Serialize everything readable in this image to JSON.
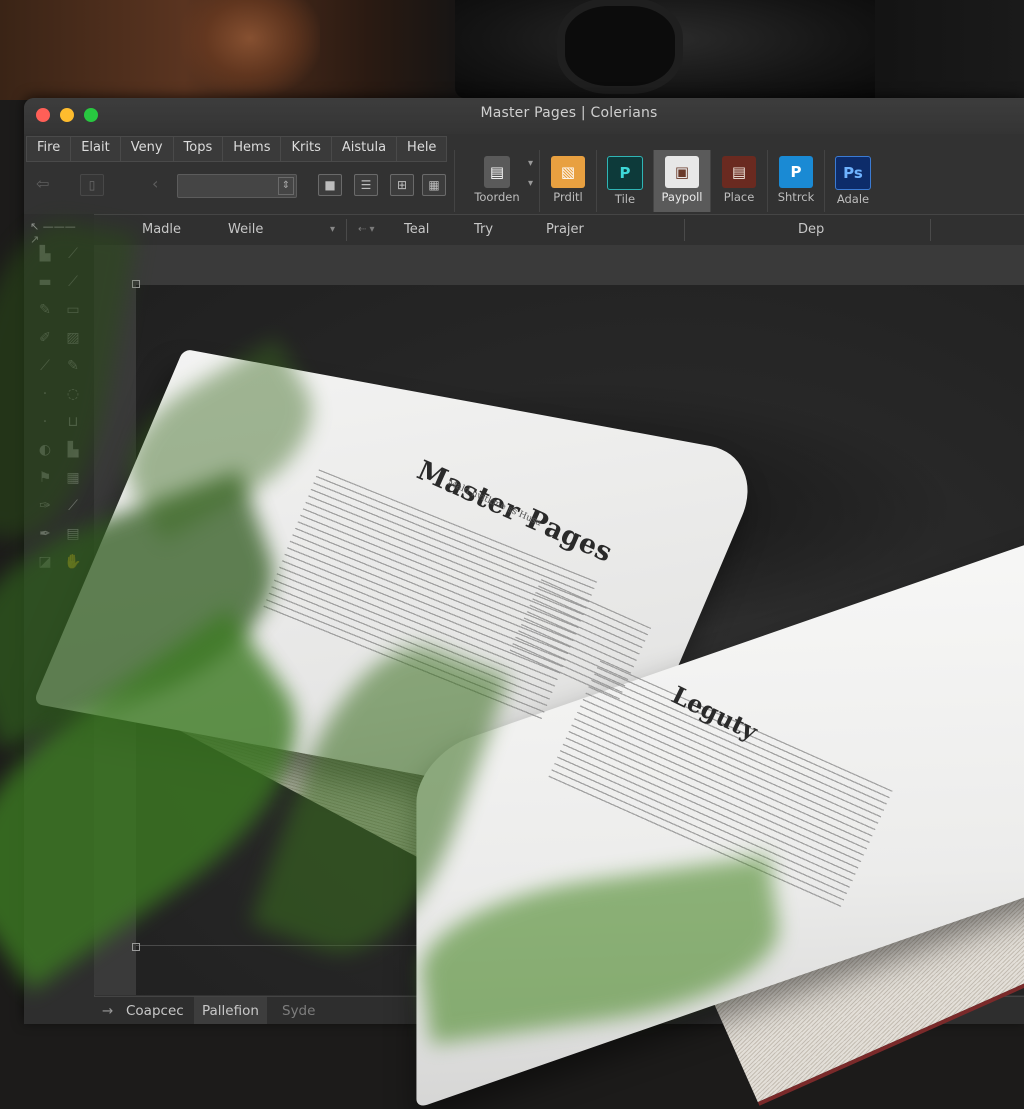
{
  "window": {
    "title": "Master Pages | Colerians"
  },
  "menu": [
    "Fire",
    "Elait",
    "Veny",
    "Tops",
    "Hems",
    "Krits",
    "Aistula",
    "Hele"
  ],
  "apps": [
    {
      "label": "Toorden",
      "icon": "tools-icon",
      "color": "#5a5a5a"
    },
    {
      "label": "Prditl",
      "icon": "layout-icon",
      "color": "#e8a040"
    },
    {
      "label": "Tile",
      "icon": "p-app-icon",
      "color": "#0d3a3a",
      "glyph": "P"
    },
    {
      "label": "Paypoll",
      "icon": "photo-collage-icon",
      "color": "#e7e7e7",
      "active": true
    },
    {
      "label": "Place",
      "icon": "place-document-icon",
      "color": "#6a2a20"
    },
    {
      "label": "Shtrck",
      "icon": "p-cloud-icon",
      "color": "#1a8ad4",
      "glyph": "P"
    },
    {
      "label": "Adale",
      "icon": "ps-app-icon",
      "color": "#0d2c6a",
      "glyph": "Ps"
    }
  ],
  "subbar": {
    "first": "Madle",
    "second": "Weile",
    "third": "Teal",
    "fourth": "Try",
    "fifth": "Prajer",
    "sixth": "Dep"
  },
  "status": {
    "left": "Coapcec",
    "middle": "Pallefion",
    "right": "Syde"
  },
  "book": {
    "left_title": "Master Pages",
    "left_subtitle": "Mald hvitkme ss Husa",
    "right_title": "Leguty"
  }
}
